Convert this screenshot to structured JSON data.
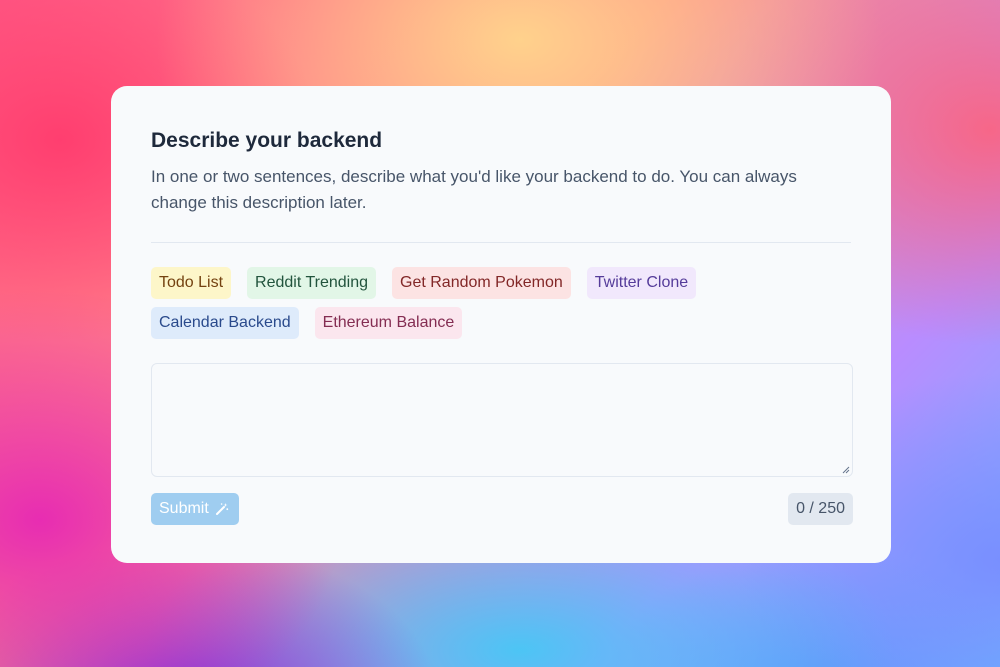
{
  "card": {
    "title": "Describe your backend",
    "description": "In one or two sentences, describe what you'd like your backend to do. You can always change this description later."
  },
  "suggestions": [
    {
      "label": "Todo List",
      "color": "#fdf6c9"
    },
    {
      "label": "Reddit Trending",
      "color": "#e2f6e7"
    },
    {
      "label": "Get Random Pokemon",
      "color": "#fce3e3"
    },
    {
      "label": "Twitter Clone",
      "color": "#f1e8fc"
    },
    {
      "label": "Calendar Backend",
      "color": "#deebfb"
    },
    {
      "label": "Ethereum Balance",
      "color": "#fbe6ee"
    }
  ],
  "prompt_input": {
    "value": "",
    "max_length": 250
  },
  "submit": {
    "label": "Submit",
    "icon": "magic-wand-icon",
    "disabled": true
  },
  "counter": {
    "text": "0 / 250"
  },
  "colors": {
    "accent": "#3182ce",
    "card_background": "#f8fafc"
  }
}
